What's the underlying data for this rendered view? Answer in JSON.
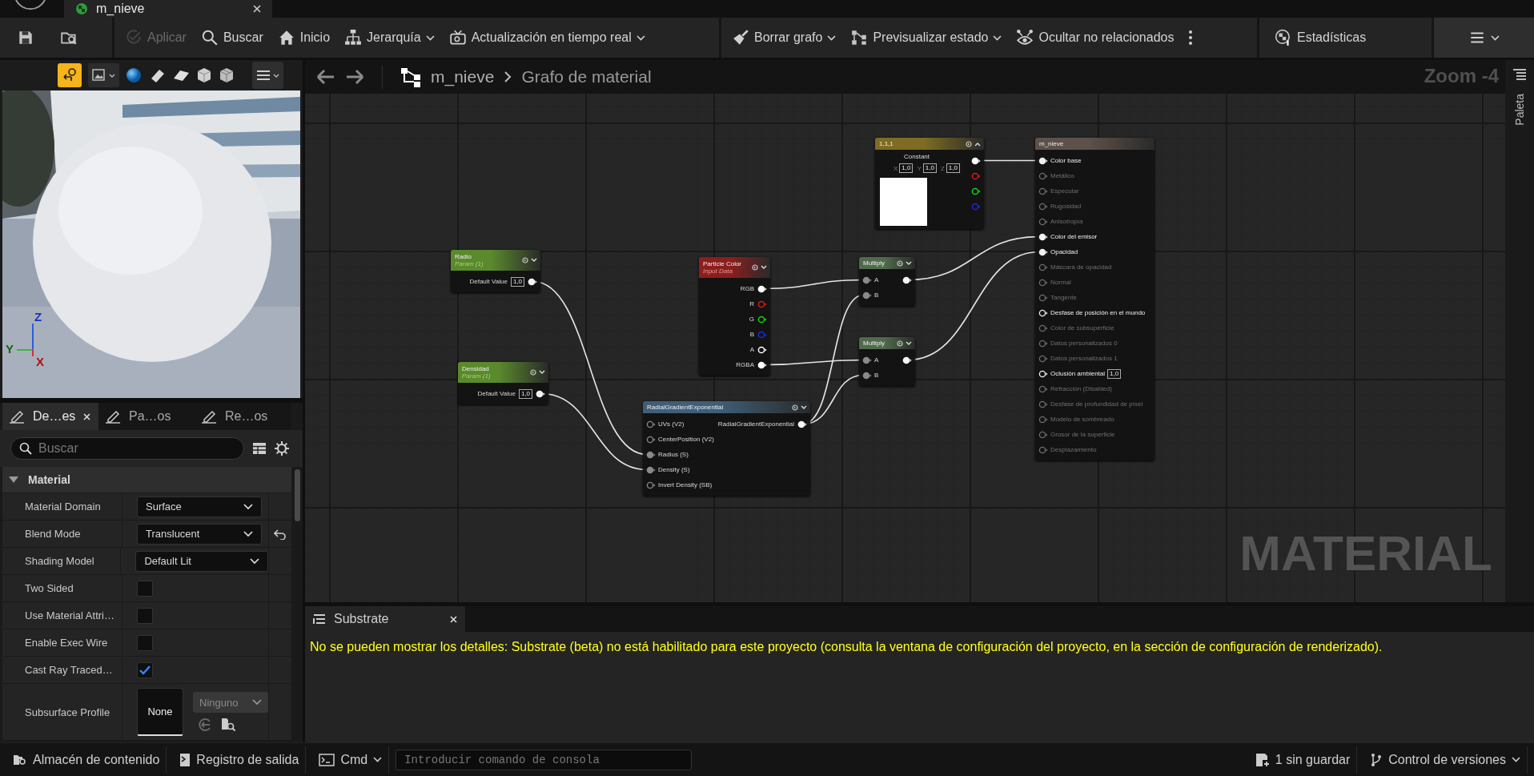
{
  "editor_tab": {
    "title": "m_nieve"
  },
  "toolbar": {
    "groups": [
      [
        {
          "dropdown": false,
          "disabled": false
        },
        {
          "dropdown": false,
          "disabled": false
        }
      ],
      [
        {
          "label": "Aplicar",
          "dropdown": false,
          "disabled": true
        },
        {
          "label": "Buscar",
          "dropdown": false,
          "disabled": false
        },
        {
          "label": "Inicio",
          "dropdown": false,
          "disabled": false
        },
        {
          "label": "Jerarquía",
          "dropdown": true,
          "disabled": false
        },
        {
          "label": "Actualización en tiempo real",
          "dropdown": true,
          "disabled": false
        }
      ],
      [
        {
          "label": "Borrar grafo",
          "dropdown": true,
          "disabled": false
        },
        {
          "label": "Previsualizar estado",
          "dropdown": true,
          "disabled": false
        },
        {
          "label": "Ocultar no relacionados",
          "dropdown": false,
          "disabled": false
        },
        {
          "dropdown": false,
          "disabled": false
        }
      ],
      [
        {
          "label": "Estadísticas",
          "dropdown": false,
          "disabled": false
        }
      ],
      [
        {
          "dropdown": true,
          "disabled": false
        }
      ]
    ]
  },
  "viewport": {
    "realtime": {
      "on": true
    },
    "gizmo_labels": [
      "Z",
      "Y",
      "X"
    ]
  },
  "details": {
    "tabs": [
      {
        "label": "De…es",
        "selected": true,
        "closable": true
      },
      {
        "label": "Pa…os",
        "selected": false,
        "closable": false
      },
      {
        "label": "Re…os",
        "selected": false,
        "closable": false
      }
    ],
    "search": {
      "placeholder": "Buscar"
    },
    "category": {
      "label": "Material",
      "expanded": true
    },
    "properties": [
      {
        "label": "Material Domain",
        "kind": "dropdown",
        "value": "Surface",
        "reset": false
      },
      {
        "label": "Blend Mode",
        "kind": "dropdown",
        "value": "Translucent",
        "reset": true
      },
      {
        "label": "Shading Model",
        "kind": "dropdown",
        "value": "Default Lit",
        "reset": false
      },
      {
        "label": "Two Sided",
        "kind": "checkbox",
        "checked": false,
        "reset": false
      },
      {
        "label": "Use Material Attri…",
        "kind": "checkbox",
        "checked": false,
        "reset": false
      },
      {
        "label": "Enable Exec Wire",
        "kind": "checkbox",
        "checked": false,
        "reset": false
      },
      {
        "label": "Cast Ray Traced…",
        "kind": "checkbox",
        "checked": true,
        "reset": false
      },
      {
        "label": "Subsurface Profile",
        "kind": "asset",
        "value": "None",
        "picker": "Ninguno",
        "reset": false
      }
    ]
  },
  "graph": {
    "breadcrumb": [
      "m_nieve",
      "Grafo de material"
    ],
    "zoom": "Zoom -4",
    "watermark": "MATERIAL",
    "nodes": [
      {
        "kind": "constant",
        "title": "1,1,1",
        "label": "Constant",
        "values": [
          {
            "axis": "X",
            "value": "1,0"
          },
          {
            "axis": "Y",
            "value": "1,0"
          },
          {
            "axis": "Z",
            "value": "1,0"
          }
        ],
        "outputs": [
          {
            "connected": true,
            "color": "#ffffff"
          },
          {
            "connected": false,
            "color": "#e01818"
          },
          {
            "connected": false,
            "color": "#18d018"
          },
          {
            "connected": false,
            "color": "#1828e8"
          }
        ]
      },
      {
        "kind": "output",
        "title": "m_nieve",
        "inputs": [
          {
            "label": "Color base",
            "connected": true,
            "disabled": false
          },
          {
            "label": "Metálico",
            "connected": false,
            "disabled": true
          },
          {
            "label": "Especular",
            "connected": false,
            "disabled": true
          },
          {
            "label": "Rugosidad",
            "connected": false,
            "disabled": true
          },
          {
            "label": "Anisotropía",
            "connected": false,
            "disabled": true
          },
          {
            "label": "Color del emisor",
            "connected": true,
            "disabled": false
          },
          {
            "label": "Opacidad",
            "connected": true,
            "disabled": false
          },
          {
            "label": "Máscara de opacidad",
            "connected": false,
            "disabled": true
          },
          {
            "label": "Normal",
            "connected": false,
            "disabled": true
          },
          {
            "label": "Tangente",
            "connected": false,
            "disabled": true
          },
          {
            "label": "Desfase de posición en el mundo",
            "connected": false,
            "disabled": false
          },
          {
            "label": "Color de subsuperficie",
            "connected": false,
            "disabled": true
          },
          {
            "label": "Datos personalizados 0",
            "connected": false,
            "disabled": true
          },
          {
            "label": "Datos personalizados 1",
            "connected": false,
            "disabled": true
          },
          {
            "label": "Oclusión ambiental",
            "connected": false,
            "disabled": false,
            "value": "1,0"
          },
          {
            "label": "Refracción (Disabled)",
            "connected": false,
            "disabled": true
          },
          {
            "label": "Desfase de profundidad de píxel",
            "connected": false,
            "disabled": true
          },
          {
            "label": "Modelo de sombreado",
            "connected": false,
            "disabled": true
          },
          {
            "label": "Grosor de la superficie",
            "connected": false,
            "disabled": true
          },
          {
            "label": "Desplazamiento",
            "connected": false,
            "disabled": true
          }
        ]
      },
      {
        "kind": "param",
        "title": "Radio",
        "subtitle": "Param (1)",
        "outputs": [
          {
            "label": "Default Value",
            "value": "1,0",
            "connected": true
          }
        ]
      },
      {
        "kind": "param",
        "title": "Densidad",
        "subtitle": "Param (1)",
        "outputs": [
          {
            "label": "Default Value",
            "value": "1,0",
            "connected": true
          }
        ]
      },
      {
        "kind": "input",
        "title": "Particle Color",
        "subtitle": "Input Data",
        "outputs": [
          {
            "label": "RGB",
            "connected": true,
            "color": "#ffffff"
          },
          {
            "label": "R",
            "connected": false,
            "color": "#e01818"
          },
          {
            "label": "G",
            "connected": false,
            "color": "#18d018"
          },
          {
            "label": "B",
            "connected": false,
            "color": "#1828e8"
          },
          {
            "label": "A",
            "connected": false,
            "color": "#ffffff"
          },
          {
            "label": "RGBA",
            "connected": true,
            "color": "#ffffff"
          }
        ]
      },
      {
        "kind": "math",
        "title": "Multiply",
        "inputs": [
          {
            "label": "A",
            "connected": true
          },
          {
            "label": "B",
            "connected": true
          }
        ],
        "outputs": [
          {
            "connected": true
          }
        ]
      },
      {
        "kind": "math",
        "title": "Multiply",
        "inputs": [
          {
            "label": "A",
            "connected": true
          },
          {
            "label": "B",
            "connected": true
          }
        ],
        "outputs": [
          {
            "connected": true
          }
        ]
      },
      {
        "kind": "function",
        "title": "RadialGradientExponential",
        "inputs": [
          {
            "label": "UVs (V2)",
            "connected": false
          },
          {
            "label": "CenterPosition (V2)",
            "connected": false
          },
          {
            "label": "Radius (S)",
            "connected": true
          },
          {
            "label": "Density (S)",
            "connected": true
          },
          {
            "label": "Invert Density (SB)",
            "connected": false
          }
        ],
        "outputs": [
          {
            "label": "RadialGradientExponential",
            "connected": true
          }
        ]
      }
    ]
  },
  "palette": {
    "label": "Paleta"
  },
  "substrate": {
    "tab": "Substrate",
    "message": "No se pueden mostrar los detalles: Substrate (beta) no está habilitado para este proyecto (consulta la ventana de configuración del proyecto, en la sección de configuración de renderizado)."
  },
  "status_bar": {
    "content_browser": "Almacén de contenido",
    "output_log": "Registro de salida",
    "cmd": "Cmd",
    "console": {
      "placeholder": "Introducir comando de consola"
    },
    "unsaved": "1 sin guardar",
    "source_control": "Control de versiones"
  }
}
